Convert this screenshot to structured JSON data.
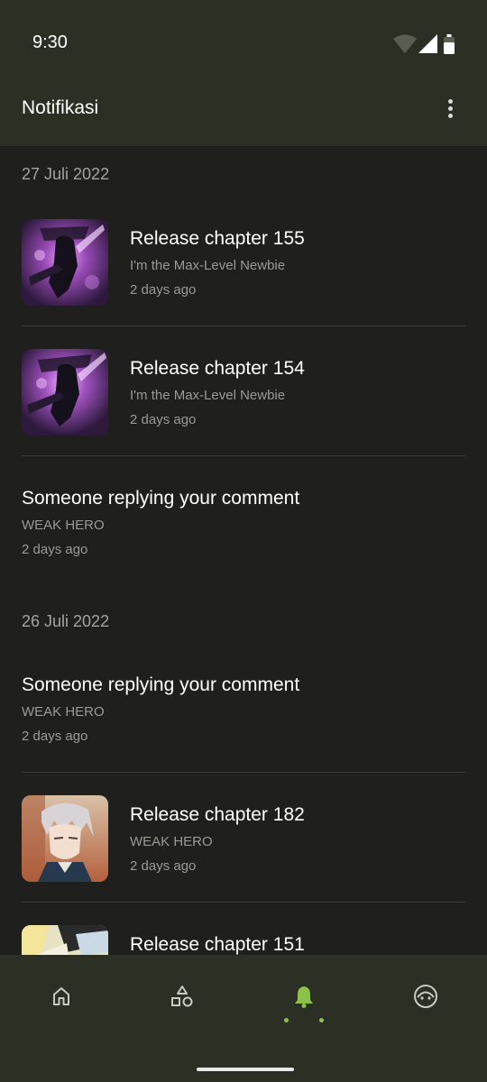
{
  "status_bar": {
    "time": "9:30"
  },
  "app_bar": {
    "title": "Notifikasi"
  },
  "groups": [
    {
      "date": "27 Juli 2022",
      "items": [
        {
          "title": "Release chapter 155",
          "subtitle": "I'm the Max-Level Newbie",
          "time": "2 days ago",
          "thumbnail": "max-level-newbie-cover"
        },
        {
          "title": "Release chapter 154",
          "subtitle": "I'm the Max-Level Newbie",
          "time": "2 days ago",
          "thumbnail": "max-level-newbie-cover"
        },
        {
          "title": "Someone replying your comment",
          "subtitle": "WEAK HERO",
          "time": "2 days ago"
        }
      ]
    },
    {
      "date": "26 Juli 2022",
      "items": [
        {
          "title": "Someone replying your comment",
          "subtitle": "WEAK HERO",
          "time": "2 days ago"
        },
        {
          "title": "Release chapter 182",
          "subtitle": "WEAK HERO",
          "time": "2 days ago",
          "thumbnail": "weak-hero-cover"
        },
        {
          "title": "Release chapter 151",
          "thumbnail": "comic-cover"
        }
      ]
    }
  ],
  "bottom_nav": {
    "items": [
      {
        "icon": "home-icon",
        "active": false
      },
      {
        "icon": "explore-shapes-icon",
        "active": false
      },
      {
        "icon": "bell-icon",
        "active": true
      },
      {
        "icon": "profile-icon",
        "active": false
      }
    ],
    "active_color": "#8bc34a",
    "inactive_color": "#c9c9c2"
  },
  "colors": {
    "background": "#1f1f1d",
    "bar": "#2b2f24",
    "accent": "#8bc34a"
  }
}
